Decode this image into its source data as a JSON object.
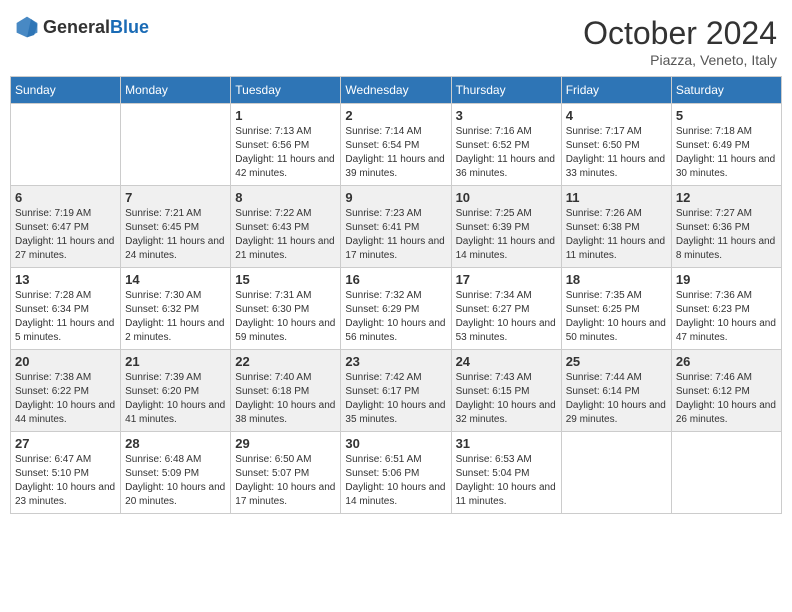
{
  "header": {
    "logo_general": "General",
    "logo_blue": "Blue",
    "month_title": "October 2024",
    "subtitle": "Piazza, Veneto, Italy"
  },
  "days_of_week": [
    "Sunday",
    "Monday",
    "Tuesday",
    "Wednesday",
    "Thursday",
    "Friday",
    "Saturday"
  ],
  "weeks": [
    [
      {
        "day": "",
        "info": ""
      },
      {
        "day": "",
        "info": ""
      },
      {
        "day": "1",
        "info": "Sunrise: 7:13 AM\nSunset: 6:56 PM\nDaylight: 11 hours and 42 minutes."
      },
      {
        "day": "2",
        "info": "Sunrise: 7:14 AM\nSunset: 6:54 PM\nDaylight: 11 hours and 39 minutes."
      },
      {
        "day": "3",
        "info": "Sunrise: 7:16 AM\nSunset: 6:52 PM\nDaylight: 11 hours and 36 minutes."
      },
      {
        "day": "4",
        "info": "Sunrise: 7:17 AM\nSunset: 6:50 PM\nDaylight: 11 hours and 33 minutes."
      },
      {
        "day": "5",
        "info": "Sunrise: 7:18 AM\nSunset: 6:49 PM\nDaylight: 11 hours and 30 minutes."
      }
    ],
    [
      {
        "day": "6",
        "info": "Sunrise: 7:19 AM\nSunset: 6:47 PM\nDaylight: 11 hours and 27 minutes."
      },
      {
        "day": "7",
        "info": "Sunrise: 7:21 AM\nSunset: 6:45 PM\nDaylight: 11 hours and 24 minutes."
      },
      {
        "day": "8",
        "info": "Sunrise: 7:22 AM\nSunset: 6:43 PM\nDaylight: 11 hours and 21 minutes."
      },
      {
        "day": "9",
        "info": "Sunrise: 7:23 AM\nSunset: 6:41 PM\nDaylight: 11 hours and 17 minutes."
      },
      {
        "day": "10",
        "info": "Sunrise: 7:25 AM\nSunset: 6:39 PM\nDaylight: 11 hours and 14 minutes."
      },
      {
        "day": "11",
        "info": "Sunrise: 7:26 AM\nSunset: 6:38 PM\nDaylight: 11 hours and 11 minutes."
      },
      {
        "day": "12",
        "info": "Sunrise: 7:27 AM\nSunset: 6:36 PM\nDaylight: 11 hours and 8 minutes."
      }
    ],
    [
      {
        "day": "13",
        "info": "Sunrise: 7:28 AM\nSunset: 6:34 PM\nDaylight: 11 hours and 5 minutes."
      },
      {
        "day": "14",
        "info": "Sunrise: 7:30 AM\nSunset: 6:32 PM\nDaylight: 11 hours and 2 minutes."
      },
      {
        "day": "15",
        "info": "Sunrise: 7:31 AM\nSunset: 6:30 PM\nDaylight: 10 hours and 59 minutes."
      },
      {
        "day": "16",
        "info": "Sunrise: 7:32 AM\nSunset: 6:29 PM\nDaylight: 10 hours and 56 minutes."
      },
      {
        "day": "17",
        "info": "Sunrise: 7:34 AM\nSunset: 6:27 PM\nDaylight: 10 hours and 53 minutes."
      },
      {
        "day": "18",
        "info": "Sunrise: 7:35 AM\nSunset: 6:25 PM\nDaylight: 10 hours and 50 minutes."
      },
      {
        "day": "19",
        "info": "Sunrise: 7:36 AM\nSunset: 6:23 PM\nDaylight: 10 hours and 47 minutes."
      }
    ],
    [
      {
        "day": "20",
        "info": "Sunrise: 7:38 AM\nSunset: 6:22 PM\nDaylight: 10 hours and 44 minutes."
      },
      {
        "day": "21",
        "info": "Sunrise: 7:39 AM\nSunset: 6:20 PM\nDaylight: 10 hours and 41 minutes."
      },
      {
        "day": "22",
        "info": "Sunrise: 7:40 AM\nSunset: 6:18 PM\nDaylight: 10 hours and 38 minutes."
      },
      {
        "day": "23",
        "info": "Sunrise: 7:42 AM\nSunset: 6:17 PM\nDaylight: 10 hours and 35 minutes."
      },
      {
        "day": "24",
        "info": "Sunrise: 7:43 AM\nSunset: 6:15 PM\nDaylight: 10 hours and 32 minutes."
      },
      {
        "day": "25",
        "info": "Sunrise: 7:44 AM\nSunset: 6:14 PM\nDaylight: 10 hours and 29 minutes."
      },
      {
        "day": "26",
        "info": "Sunrise: 7:46 AM\nSunset: 6:12 PM\nDaylight: 10 hours and 26 minutes."
      }
    ],
    [
      {
        "day": "27",
        "info": "Sunrise: 6:47 AM\nSunset: 5:10 PM\nDaylight: 10 hours and 23 minutes."
      },
      {
        "day": "28",
        "info": "Sunrise: 6:48 AM\nSunset: 5:09 PM\nDaylight: 10 hours and 20 minutes."
      },
      {
        "day": "29",
        "info": "Sunrise: 6:50 AM\nSunset: 5:07 PM\nDaylight: 10 hours and 17 minutes."
      },
      {
        "day": "30",
        "info": "Sunrise: 6:51 AM\nSunset: 5:06 PM\nDaylight: 10 hours and 14 minutes."
      },
      {
        "day": "31",
        "info": "Sunrise: 6:53 AM\nSunset: 5:04 PM\nDaylight: 10 hours and 11 minutes."
      },
      {
        "day": "",
        "info": ""
      },
      {
        "day": "",
        "info": ""
      }
    ]
  ]
}
